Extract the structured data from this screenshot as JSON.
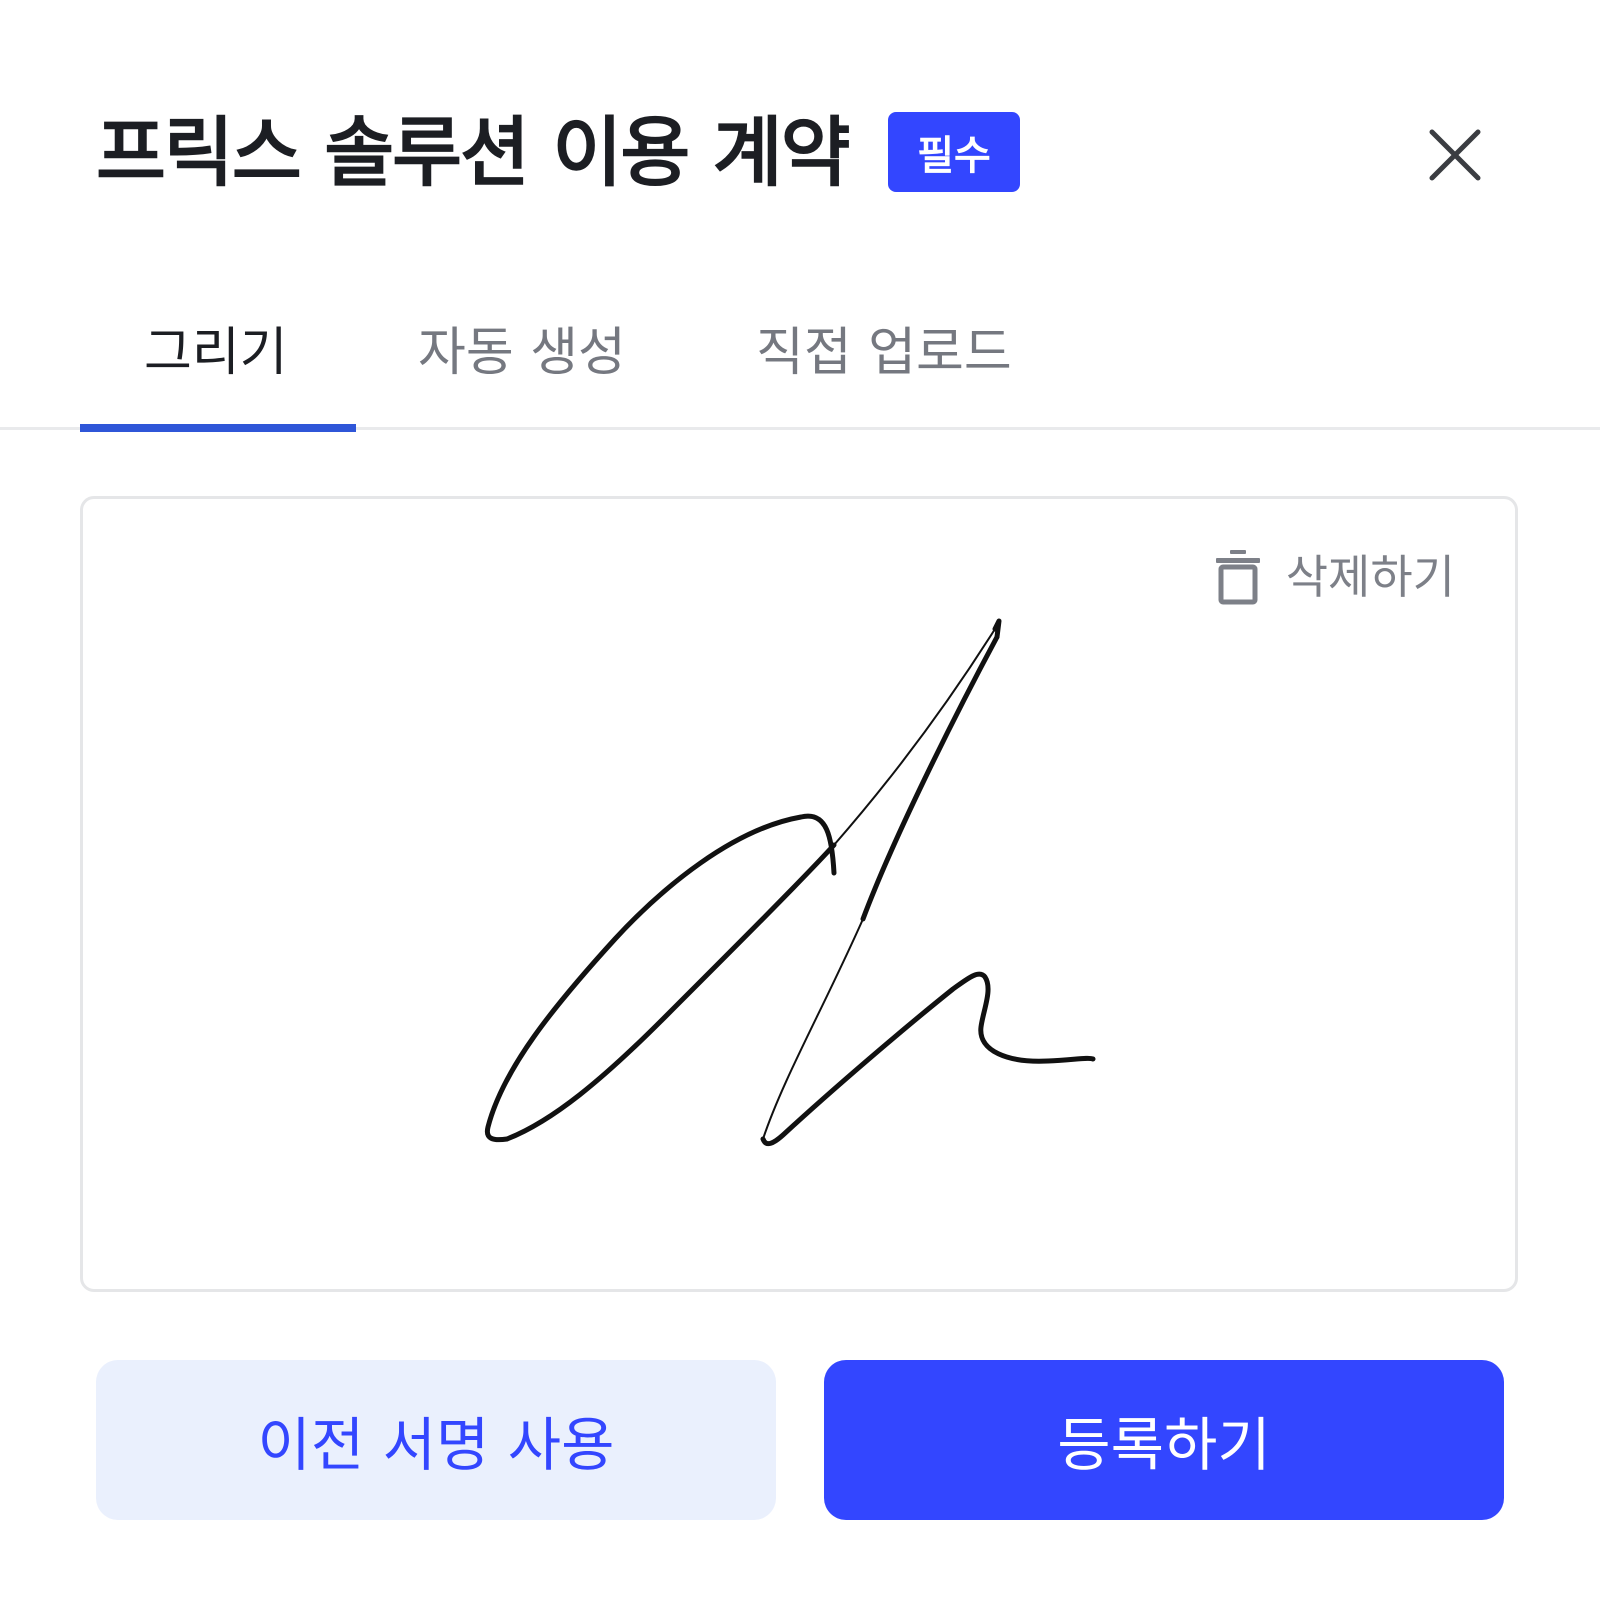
{
  "header": {
    "title": "프릭스 솔루션 이용 계약",
    "badge": "필수",
    "close_icon": "close-icon"
  },
  "tabs": [
    {
      "label": "그리기",
      "active": true
    },
    {
      "label": "자동 생성",
      "active": false
    },
    {
      "label": "직접 업로드",
      "active": false
    }
  ],
  "sign_pad": {
    "delete_label": "삭제하기",
    "delete_icon": "trash-icon"
  },
  "actions": {
    "previous_signature_label": "이전 서명 사용",
    "register_label": "등록하기"
  },
  "colors": {
    "accent": "#3346ff",
    "tab_underline": "#2f56d8",
    "secondary_button_bg": "#eaf0fd"
  }
}
